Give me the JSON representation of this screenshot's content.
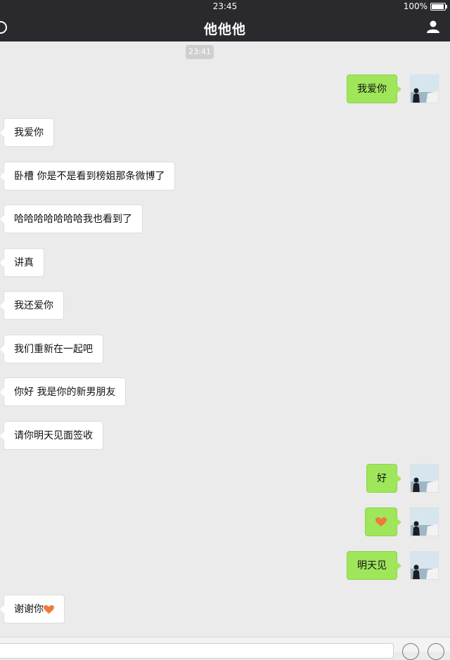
{
  "status_bar": {
    "time": "23:45",
    "battery": "100%",
    "battery_fraction": 1.0
  },
  "nav": {
    "title": "他他他"
  },
  "chat": {
    "timestamp": "23:41",
    "messages": [
      {
        "side": "out",
        "text": "我爱你"
      },
      {
        "side": "in",
        "text": "我爱你"
      },
      {
        "side": "in",
        "text": "卧槽 你是不是看到榜姐那条微博了"
      },
      {
        "side": "in",
        "text": "哈哈哈哈哈哈哈我也看到了"
      },
      {
        "side": "in",
        "text": "讲真"
      },
      {
        "side": "in",
        "text": "我还爱你"
      },
      {
        "side": "in",
        "text": "我们重新在一起吧"
      },
      {
        "side": "in",
        "text": "你好 我是你的新男朋友"
      },
      {
        "side": "in",
        "text": "请你明天见面签收"
      },
      {
        "side": "out",
        "text": "好"
      },
      {
        "side": "out",
        "text": "",
        "emoji": "heart-icon"
      },
      {
        "side": "out",
        "text": "明天见"
      },
      {
        "side": "in",
        "text": "谢谢你",
        "emoji": "heart-icon"
      }
    ]
  },
  "colors": {
    "outgoing_bubble": "#9fe65b",
    "incoming_bubble": "#ffffff",
    "navbar": "#2a2a2e",
    "heart": "#f07a3a"
  },
  "icons": {
    "back": "back-circle-icon",
    "profile": "user-icon",
    "emoji": "emoji-icon",
    "more": "plus-icon"
  }
}
